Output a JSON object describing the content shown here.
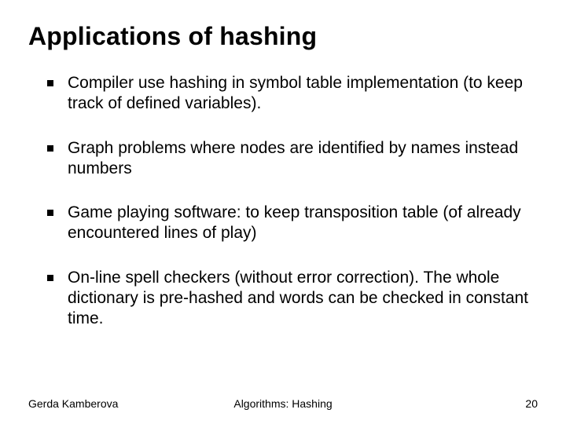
{
  "title": "Applications of  hashing",
  "bullets": [
    " Compiler use hashing in symbol table implementation (to keep track of defined variables).",
    " Graph problems where nodes are identified by names instead numbers",
    "Game playing software: to keep transposition table (of already encountered  lines of play)",
    "On-line spell checkers (without error correction). The whole dictionary is pre-hashed and words can be checked in constant time."
  ],
  "footer": {
    "left": "Gerda Kamberova",
    "center": "Algorithms: Hashing",
    "right": "20"
  }
}
